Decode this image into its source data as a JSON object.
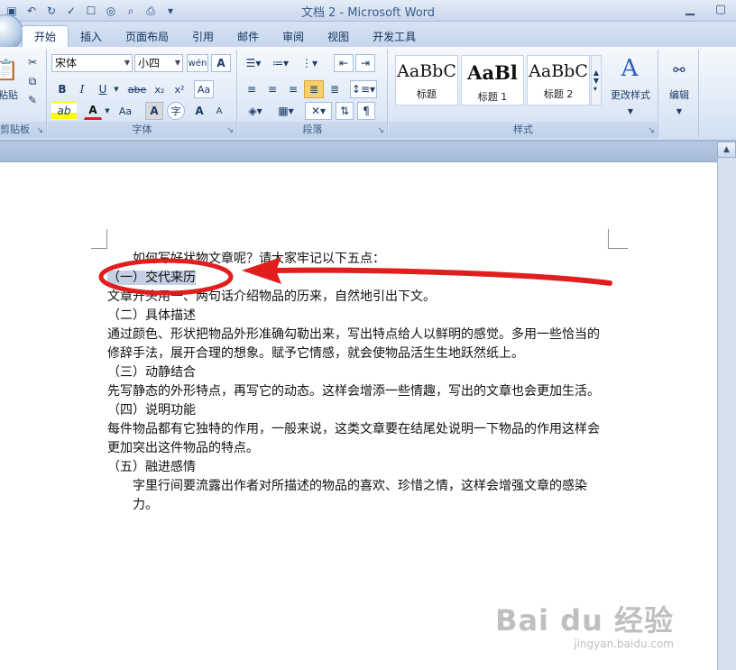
{
  "window": {
    "title": "文档 2 - Microsoft Word"
  },
  "tabs": [
    "开始",
    "插入",
    "页面布局",
    "引用",
    "邮件",
    "审阅",
    "视图",
    "开发工具"
  ],
  "clipboard_group": {
    "paste_label": "粘贴",
    "label": "剪贴板"
  },
  "font_group": {
    "font_name": "宋体",
    "font_size": "小四",
    "label": "字体",
    "bold": "B",
    "italic": "I",
    "underline": "U",
    "strike": "abe",
    "subscript": "x₂",
    "superscript": "x²",
    "font_color_letter": "A",
    "change_case": "Aa",
    "char_shading": "A",
    "grow": "A",
    "shrink": "A"
  },
  "paragraph_group": {
    "label": "段落"
  },
  "styles_group": {
    "label": "样式",
    "styles": [
      {
        "sample": "AaBbC",
        "name": "标题"
      },
      {
        "sample": "AaBl",
        "name": "标题 1"
      },
      {
        "sample": "AaBbC",
        "name": "标题 2"
      }
    ],
    "change_styles_label": "更改样式"
  },
  "editing_group": {
    "label": "编辑"
  },
  "document": {
    "lines": [
      "如何写好状物文章呢？请大家牢记以下五点：",
      "（一）交代来历",
      "文章开头用一、两句话介绍物品的历来，自然地引出下文。",
      "（二）具体描述",
      "通过颜色、形状把物品外形准确勾勒出来，写出特点给人以鲜明的感觉。多用一些恰当的修辞手法，展开合理的想象。赋予它情感，就会使物品活生生地跃然纸上。",
      "（三）动静结合",
      "先写静态的外形特点，再写它的动态。这样会增添一些情趣，写出的文章也会更加生活。",
      "（四）说明功能",
      "每件物品都有它独特的作用，一般来说，这类文章要在结尾处说明一下物品的作用这样会更加突出这件物品的特点。",
      "（五）融进感情",
      "字里行间要流露出作者对所描述的物品的喜欢、珍惜之情，这样会增强文章的感染力。"
    ]
  },
  "watermark": {
    "brand": "Bai du 经验",
    "url": "jingyan.baidu.com"
  },
  "colors": {
    "annotation": "#e01e1e",
    "selection": "#c6d0e4",
    "ribbon_accent": "#2a4f85"
  }
}
